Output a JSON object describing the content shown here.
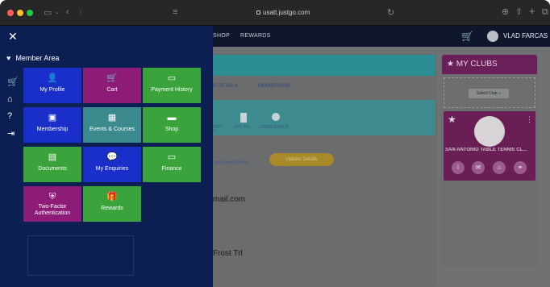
{
  "browser": {
    "url": "usatt.justgo.com"
  },
  "topbar": {
    "nav_shop": "SHOP",
    "nav_rewards": "REWARDS",
    "user_name": "VLAD FARCAS"
  },
  "profile": {
    "tab_details": "R DETAILS",
    "tab_membership": "MEMBERSHIP",
    "label_ency": "ENCY",
    "label_ct": "CT",
    "label_opt_ins": "OPT INS",
    "label_credentials": "CREDENTIALS",
    "personal_details": "personal details",
    "update_button": "Update Details",
    "email": "mail.com",
    "address": "Frost Trl"
  },
  "clubs": {
    "title": "MY CLUBS",
    "select_club": "Select Club",
    "club_name": "SAN ANTONIO TABLE TENNIS CL..."
  },
  "member_area": {
    "title": "Member Area",
    "tiles": [
      {
        "label": "My Profile",
        "icon": "user-icon",
        "color": "#1a2fc9"
      },
      {
        "label": "Cart",
        "icon": "cart-icon",
        "color": "#8c1c78"
      },
      {
        "label": "Payment History",
        "icon": "credit-card-icon",
        "color": "#3ba33c"
      },
      {
        "label": "Membership",
        "icon": "id-card-icon",
        "color": "#1a2fc9"
      },
      {
        "label": "Events & Courses",
        "icon": "calendar-icon",
        "color": "#3a8a8e"
      },
      {
        "label": "Shop",
        "icon": "shop-icon",
        "color": "#3ba33c"
      },
      {
        "label": "Documents",
        "icon": "document-icon",
        "color": "#3ba33c"
      },
      {
        "label": "My Enquiries",
        "icon": "chat-icon",
        "color": "#1a2fc9"
      },
      {
        "label": "Finance",
        "icon": "wallet-icon",
        "color": "#3ba33c"
      },
      {
        "label": "Two-Factor Authentication",
        "icon": "shield-icon",
        "color": "#8c1c78"
      },
      {
        "label": "Rewards",
        "icon": "gift-icon",
        "color": "#3ba33c"
      }
    ]
  }
}
